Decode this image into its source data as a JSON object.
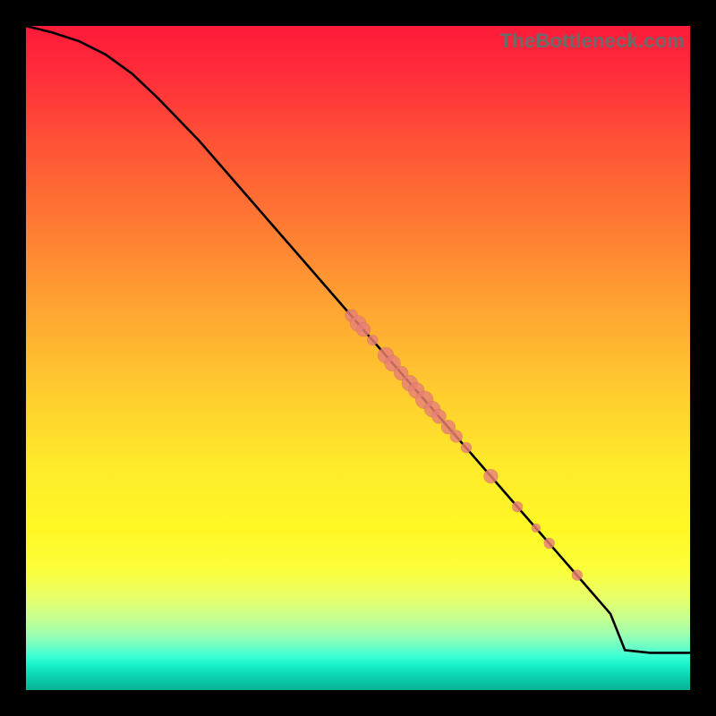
{
  "watermark": "TheBottleneck.com",
  "colors": {
    "point_fill": "#e98076",
    "curve_stroke": "#000000",
    "bg": "#000000"
  },
  "chart_data": {
    "type": "line",
    "title": "",
    "xlabel": "",
    "ylabel": "",
    "xlim": [
      0,
      100
    ],
    "ylim": [
      0,
      100
    ],
    "grid": false,
    "series": [
      {
        "name": "curve",
        "x": [
          0,
          4,
          8,
          12,
          16,
          20,
          26,
          34,
          42,
          50,
          58,
          66,
          74,
          82,
          88,
          90.2,
          94,
          100
        ],
        "y": [
          100,
          99.0,
          97.7,
          95.7,
          92.8,
          89.0,
          82.8,
          73.6,
          64.4,
          55.2,
          46.0,
          36.8,
          27.6,
          18.4,
          11.5,
          6.0,
          5.6,
          5.6
        ]
      }
    ],
    "points": [
      {
        "x": 49.0,
        "y": 56.4,
        "r": 7
      },
      {
        "x": 50.0,
        "y": 55.2,
        "r": 9
      },
      {
        "x": 50.8,
        "y": 54.3,
        "r": 8
      },
      {
        "x": 52.2,
        "y": 52.7,
        "r": 6
      },
      {
        "x": 54.2,
        "y": 50.4,
        "r": 9
      },
      {
        "x": 55.2,
        "y": 49.2,
        "r": 9
      },
      {
        "x": 56.5,
        "y": 47.7,
        "r": 8
      },
      {
        "x": 57.8,
        "y": 46.2,
        "r": 9
      },
      {
        "x": 58.8,
        "y": 45.1,
        "r": 9
      },
      {
        "x": 60.0,
        "y": 43.7,
        "r": 10
      },
      {
        "x": 61.2,
        "y": 42.3,
        "r": 9
      },
      {
        "x": 62.2,
        "y": 41.2,
        "r": 8
      },
      {
        "x": 63.6,
        "y": 39.6,
        "r": 8
      },
      {
        "x": 64.8,
        "y": 38.2,
        "r": 7
      },
      {
        "x": 66.3,
        "y": 36.5,
        "r": 6
      },
      {
        "x": 70.0,
        "y": 32.2,
        "r": 8
      },
      {
        "x": 74.0,
        "y": 27.6,
        "r": 6
      },
      {
        "x": 76.8,
        "y": 24.4,
        "r": 5
      },
      {
        "x": 78.8,
        "y": 22.1,
        "r": 6
      },
      {
        "x": 83.0,
        "y": 17.3,
        "r": 6
      }
    ]
  }
}
